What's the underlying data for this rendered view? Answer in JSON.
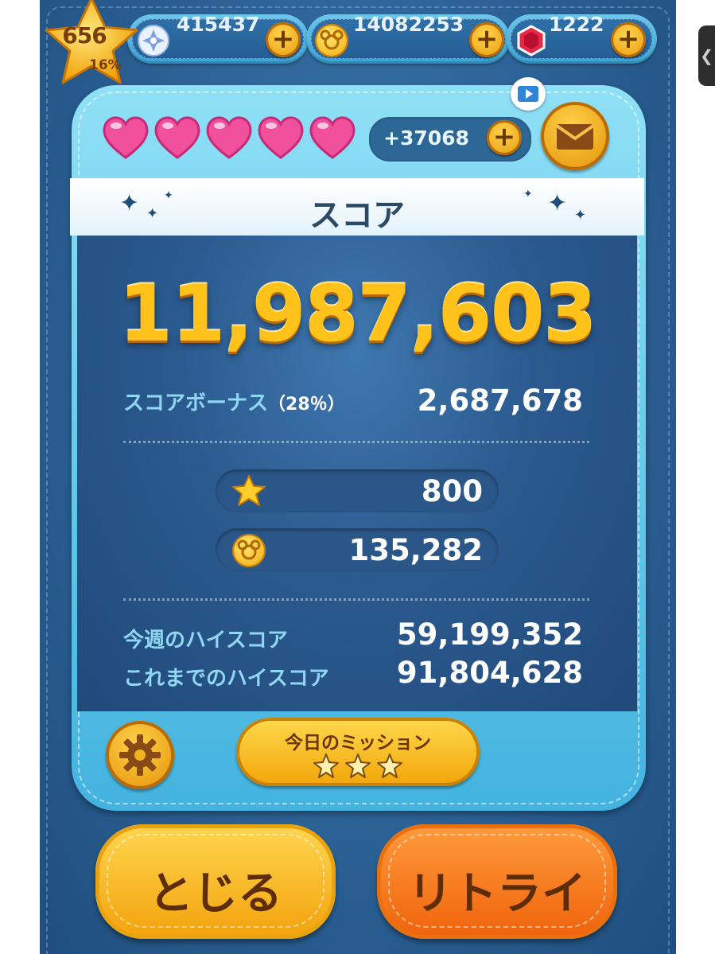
{
  "top_bar": {
    "level": "656",
    "level_progress": "16%",
    "gems": "415437",
    "coins": "14082253",
    "rubies": "1222"
  },
  "hearts": {
    "count": 5
  },
  "lives_bonus": "+37068",
  "score_panel": {
    "title": "スコア",
    "score": "11,987,603",
    "bonus_label": "スコアボーナス",
    "bonus_pct": "（28％）",
    "bonus_value": "2,687,678",
    "exp_value": "800",
    "coins_earned": "135,282",
    "weekly_high_label": "今週のハイスコア",
    "weekly_high_value": "59,199,352",
    "all_time_high_label": "これまでのハイスコア",
    "all_time_high_value": "91,804,628"
  },
  "mission": {
    "label": "今日のミッション",
    "stars": 3
  },
  "buttons": {
    "close": "とじる",
    "retry": "リトライ"
  },
  "colors": {
    "panel_blue": "#43b3df",
    "score_gold": "#ffc21a",
    "retry_orange": "#f0620b",
    "close_yellow": "#f3a20b"
  }
}
